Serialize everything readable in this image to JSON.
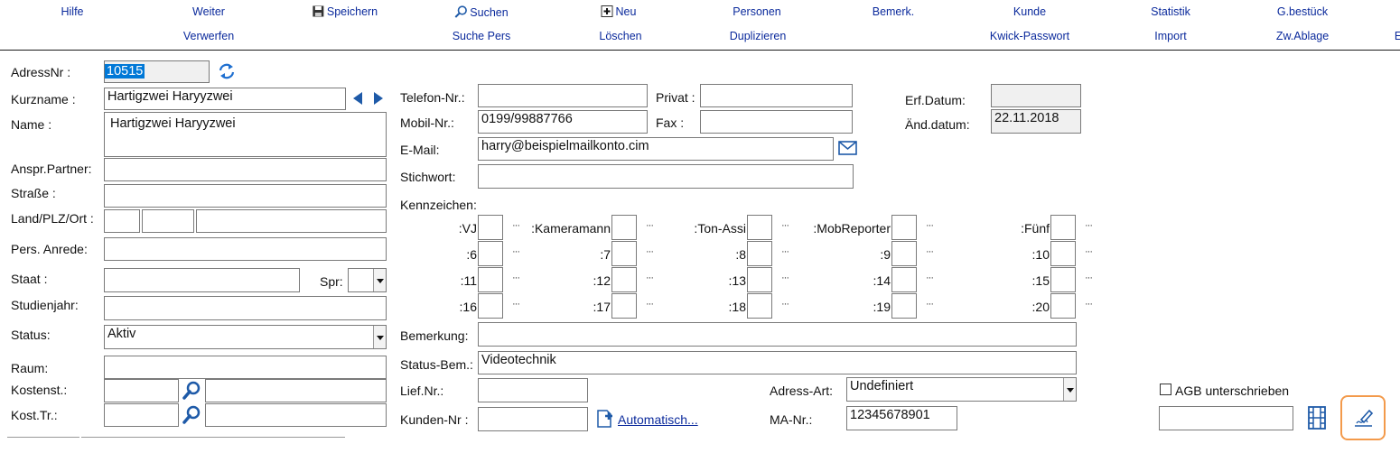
{
  "toolbar": {
    "row1": [
      {
        "id": "hilfe",
        "label": "Hilfe"
      },
      {
        "id": "weiter",
        "label": "Weiter"
      },
      {
        "id": "speichern",
        "label": "Speichern",
        "icon": "floppy-disk-icon"
      },
      {
        "id": "suchen",
        "label": "Suchen",
        "icon": "magnifier-icon"
      },
      {
        "id": "neu",
        "label": "Neu",
        "icon": "new-document-icon"
      },
      {
        "id": "personen",
        "label": "Personen"
      },
      {
        "id": "bemerk",
        "label": "Bemerk."
      },
      {
        "id": "kunde",
        "label": "Kunde"
      },
      {
        "id": "statistik",
        "label": "Statistik"
      },
      {
        "id": "gbestueck",
        "label": "G.bestück"
      }
    ],
    "row2": [
      {
        "id": "verwerfen",
        "label": "Verwerfen"
      },
      {
        "id": "suche-pers",
        "label": "Suche Pers"
      },
      {
        "id": "loeschen",
        "label": "Löschen"
      },
      {
        "id": "duplizieren",
        "label": "Duplizieren"
      },
      {
        "id": "kwick-passwort",
        "label": "Kwick-Passwort"
      },
      {
        "id": "import",
        "label": "Import"
      },
      {
        "id": "zwablage",
        "label": "Zw.Ablage"
      },
      {
        "id": "cut",
        "label": "E"
      }
    ]
  },
  "left": {
    "adressnr_label": "AdressNr :",
    "adressnr_value": "10515",
    "kurzname_label": "Kurzname :",
    "kurzname_value": "Hartigzwei Haryyzwei",
    "name_label": "Name :",
    "name_value": "Hartigzwei Haryyzwei",
    "anspr_label": "Anspr.Partner:",
    "anspr_value": "",
    "strasse_label": "Straße :",
    "strasse_value": "",
    "land_label": "Land/PLZ/Ort :",
    "land_value": "",
    "plz_value": "",
    "ort_value": "",
    "anrede_label": "Pers. Anrede:",
    "anrede_value": "",
    "staat_label": "Staat :",
    "staat_value": "",
    "spr_label": "Spr:",
    "spr_value": "",
    "studienjahr_label": "Studienjahr:",
    "studienjahr_value": "",
    "status_label": "Status:",
    "status_value": "Aktiv",
    "raum_label": "Raum:",
    "raum_value": "",
    "kostenst_label": "Kostenst.:",
    "kostenst_value": "",
    "kostenst_desc": "",
    "kosttr_label": "Kost.Tr.:",
    "kosttr_value": "",
    "kosttr_desc": ""
  },
  "middle": {
    "telefon_label": "Telefon-Nr.:",
    "telefon_value": "",
    "privat_label": "Privat :",
    "privat_value": "",
    "mobil_label": "Mobil-Nr.:",
    "mobil_value": "0199/99887766",
    "fax_label": "Fax :",
    "fax_value": "",
    "email_label": "E-Mail:",
    "email_value": "harry@beispielmailkonto.cim",
    "stichwort_label": "Stichwort:",
    "stichwort_value": "",
    "kennzeichen_label": "Kennzeichen:",
    "kennzeichen_rows": [
      [
        "VJ:",
        "Kameramann:",
        "Ton-Assi:",
        "MobReporter:",
        "Fünf:"
      ],
      [
        "6:",
        "7:",
        "8:",
        "9:",
        "10:"
      ],
      [
        "11:",
        "12:",
        "13:",
        "14:",
        "15:"
      ],
      [
        "16:",
        "17:",
        "18:",
        "19:",
        "20:"
      ]
    ],
    "dots": "···",
    "bemerkung_label": "Bemerkung:",
    "bemerkung_value": "",
    "statusbem_label": "Status-Bem.:",
    "statusbem_value": "Videotechnik",
    "liefnr_label": "Lief.Nr.:",
    "liefnr_value": "",
    "kundennr_label": "Kunden-Nr :",
    "kundennr_value": "",
    "automatisch_label": "Automatisch...",
    "adressart_label": "Adress-Art:",
    "adressart_value": "Undefiniert",
    "manr_label": "MA-Nr.:",
    "manr_value": "12345678901"
  },
  "right": {
    "erf_label": "Erf.Datum:",
    "erf_value": "",
    "aend_label": "Änd.datum:",
    "aend_value": "22.11.2018",
    "agb_label": "AGB unterschrieben",
    "agb_checked": false,
    "agb_value": ""
  },
  "colors": {
    "accent": "#0b2a9c",
    "icon_blue": "#1e6fd0",
    "highlight": "#f39a4b",
    "selection": "#0078d7"
  }
}
